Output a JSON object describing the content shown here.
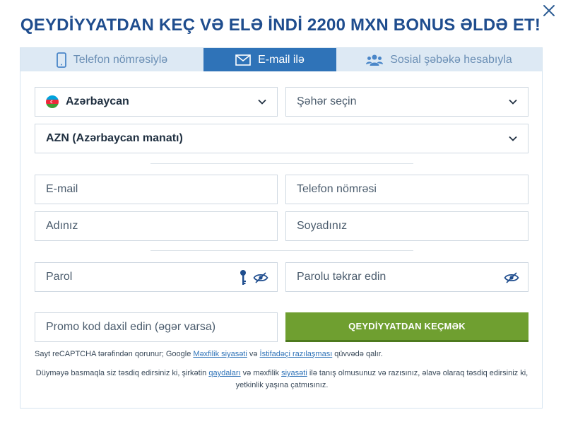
{
  "title": "QEYDİYYATDAN KEÇ VƏ ELƏ İNDİ 2200 MXN BONUS ƏLDƏ ET!",
  "tabs": [
    {
      "label": "Telefon nömrəsiylə",
      "icon": "phone-icon"
    },
    {
      "label": "E-mail ilə",
      "icon": "envelope-icon",
      "active": true
    },
    {
      "label": "Sosial şəbəkə hesabıyla",
      "icon": "users-icon"
    }
  ],
  "form": {
    "country": "Azərbaycan",
    "city_placeholder": "Şəhər seçin",
    "currency": "AZN (Azərbaycan manatı)",
    "email_placeholder": "E-mail",
    "phone_placeholder": "Telefon nömrəsi",
    "first_name_placeholder": "Adınız",
    "last_name_placeholder": "Soyadınız",
    "password_placeholder": "Parol",
    "password_repeat_placeholder": "Parolu təkrar edin",
    "promo_placeholder": "Promo kod daxil edin (əgər varsa)",
    "submit_label": "QEYDİYYATDAN KEÇMƏK"
  },
  "notes": {
    "recaptcha_prefix": "Sayt reCAPTCHA tərəfindən qorunur; Google ",
    "privacy_link": "Məxfilik siyasəti",
    "and": " və ",
    "terms_link": "İstifadəçi razılaşması",
    "recaptcha_suffix": " qüvvədə qalır.",
    "consent_prefix": "Düyməyə basmaqla siz təsdiq edirsiniz ki, şirkətin ",
    "rules_link": "qaydaları",
    "consent_mid": " və məxfilik ",
    "policy_link": "siyasəti",
    "consent_suffix": " ilə tanış olmusunuz və razısınız, əlavə olaraq təsdiq edirsiniz ki, yetkinlik yaşına çatmısınız."
  },
  "colors": {
    "brand": "#1f4d8e",
    "tab_active": "#2f73b8",
    "submit": "#6f9f30"
  }
}
